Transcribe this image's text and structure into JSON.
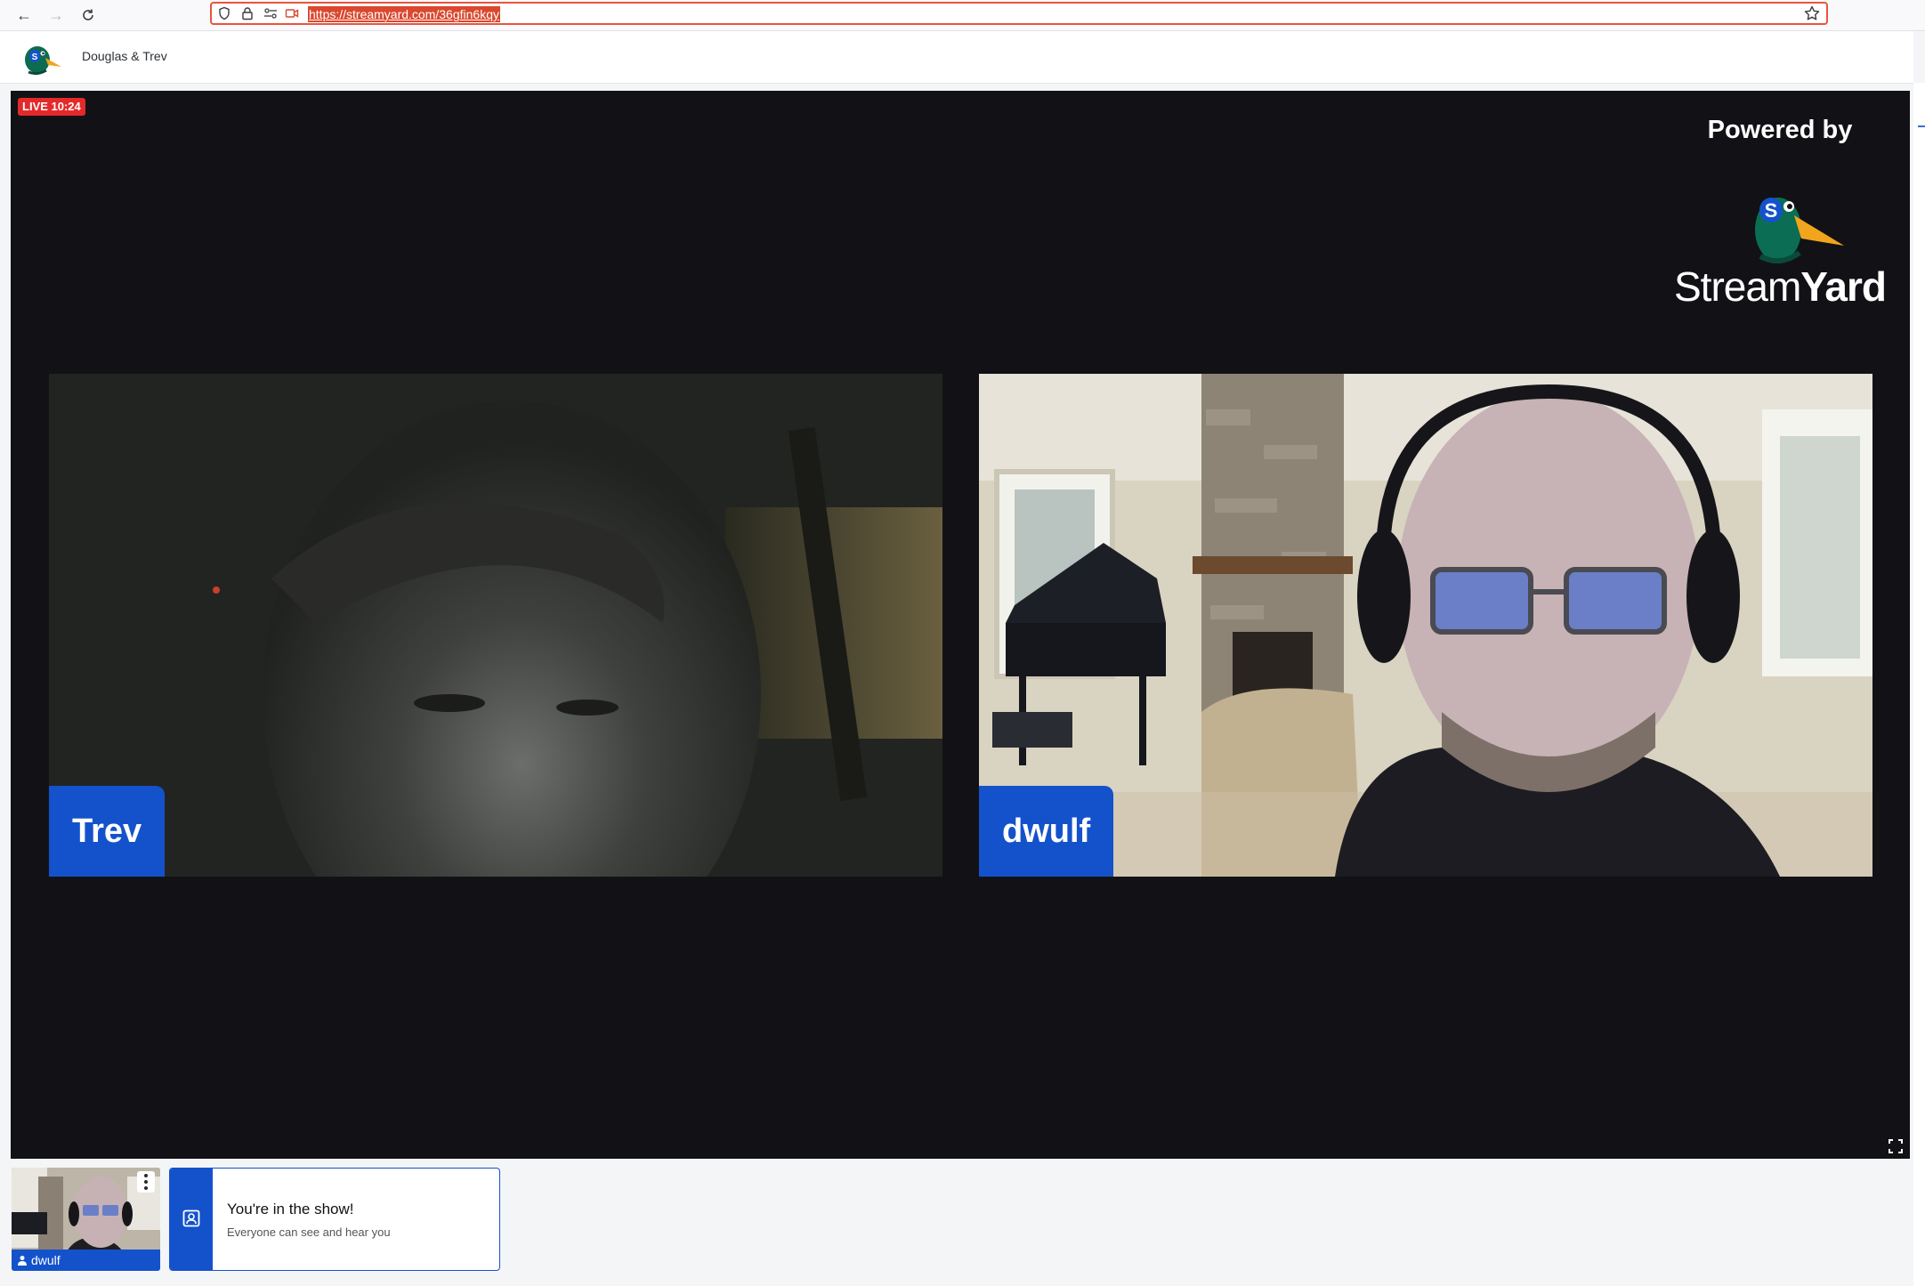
{
  "browser": {
    "url": "https://streamyard.com/36gfin6kqy",
    "icons": [
      "back-arrow-icon",
      "forward-arrow-icon",
      "reload-icon",
      "shield-icon",
      "lock-icon",
      "permissions-icon",
      "camera-sharing-icon",
      "bookmark-star-icon"
    ]
  },
  "header": {
    "broadcast_title": "Douglas & Trev"
  },
  "stage": {
    "live_badge": "LIVE 10:24",
    "powered_by": "Powered by",
    "brand_part1": "Stream",
    "brand_part2": "Yard",
    "participants": [
      {
        "name": "Trev"
      },
      {
        "name": "dwulf"
      }
    ]
  },
  "tray": {
    "self_name": "dwulf",
    "notice_title": "You're in the show!",
    "notice_subtitle": "Everyone can see and hear you"
  },
  "colors": {
    "live_red": "#e5292a",
    "accent_blue": "#1452cc",
    "stage_bg": "#121216",
    "url_highlight": "#d9482f"
  }
}
